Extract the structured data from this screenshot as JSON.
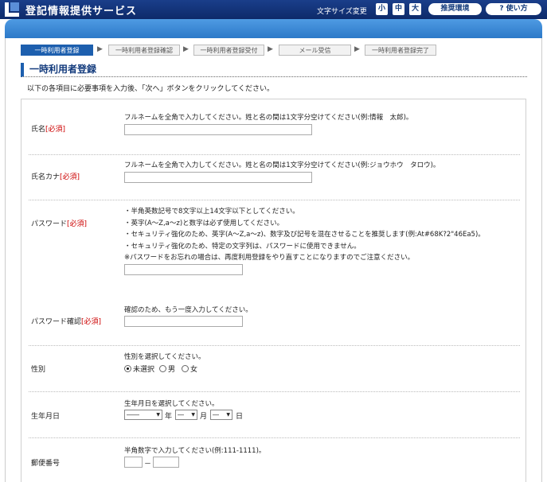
{
  "header": {
    "site_title": "登記情報提供サービス",
    "font_size_label": "文字サイズ変更",
    "font_small": "小",
    "font_medium": "中",
    "font_large": "大",
    "recommended_env": "推奨環境",
    "how_to_use": "? 使い方"
  },
  "steps": [
    {
      "label": "一時利用者登録",
      "active": true
    },
    {
      "label": "一時利用者登録確認",
      "active": false
    },
    {
      "label": "一時利用者登録受付",
      "active": false
    },
    {
      "label": "メール受信",
      "active": false
    },
    {
      "label": "一時利用者登録完了",
      "active": false
    }
  ],
  "page_title": "一時利用者登録",
  "instruction": "以下の各項目に必要事項を入力後、「次へ」ボタンをクリックしてください。",
  "required_mark": "[必須]",
  "fields": {
    "name": {
      "label": "氏名",
      "desc": "フルネームを全角で入力してください。姓と名の間は1文字分空けてください(例:情報　太郎)。"
    },
    "name_kana": {
      "label": "氏名カナ",
      "desc": "フルネームを全角で入力してください。姓と名の間は1文字分空けてください(例:ジョウホウ　タロウ)。"
    },
    "password": {
      "label": "パスワード",
      "desc_lines": [
        "・半角英数記号で8文字以上14文字以下としてください。",
        "・英字(A～Z,a～z)と数字は必ず使用してください。",
        "・セキュリティ強化のため、英字(A～Z,a～z)、数字及び記号を混在させることを推奨します(例:At#68K?2\"46Ea5)。",
        "・セキュリティ強化のため、特定の文字列は、パスワードに使用できません。",
        "※パスワードをお忘れの場合は、再度利用登録をやり直すことになりますのでご注意ください。"
      ]
    },
    "password_confirm": {
      "label": "パスワード確認",
      "desc": "確認のため、もう一度入力してください。"
    },
    "gender": {
      "label": "性別",
      "desc": "性別を選択してください。",
      "options": [
        "未選択",
        "男",
        "女"
      ],
      "selected": "未選択"
    },
    "birthdate": {
      "label": "生年月日",
      "desc": "生年月日を選択してください。",
      "year_value": "――",
      "year_unit": "年",
      "month_value": "―",
      "month_unit": "月",
      "day_value": "―",
      "day_unit": "日"
    },
    "postal": {
      "label": "郵便番号",
      "desc": "半角数字で入力してください(例:111-1111)。",
      "separator": "－"
    }
  },
  "colors": {
    "header_bg": "#0d2a6a",
    "accent": "#1d5fae",
    "required": "#cc0000"
  }
}
